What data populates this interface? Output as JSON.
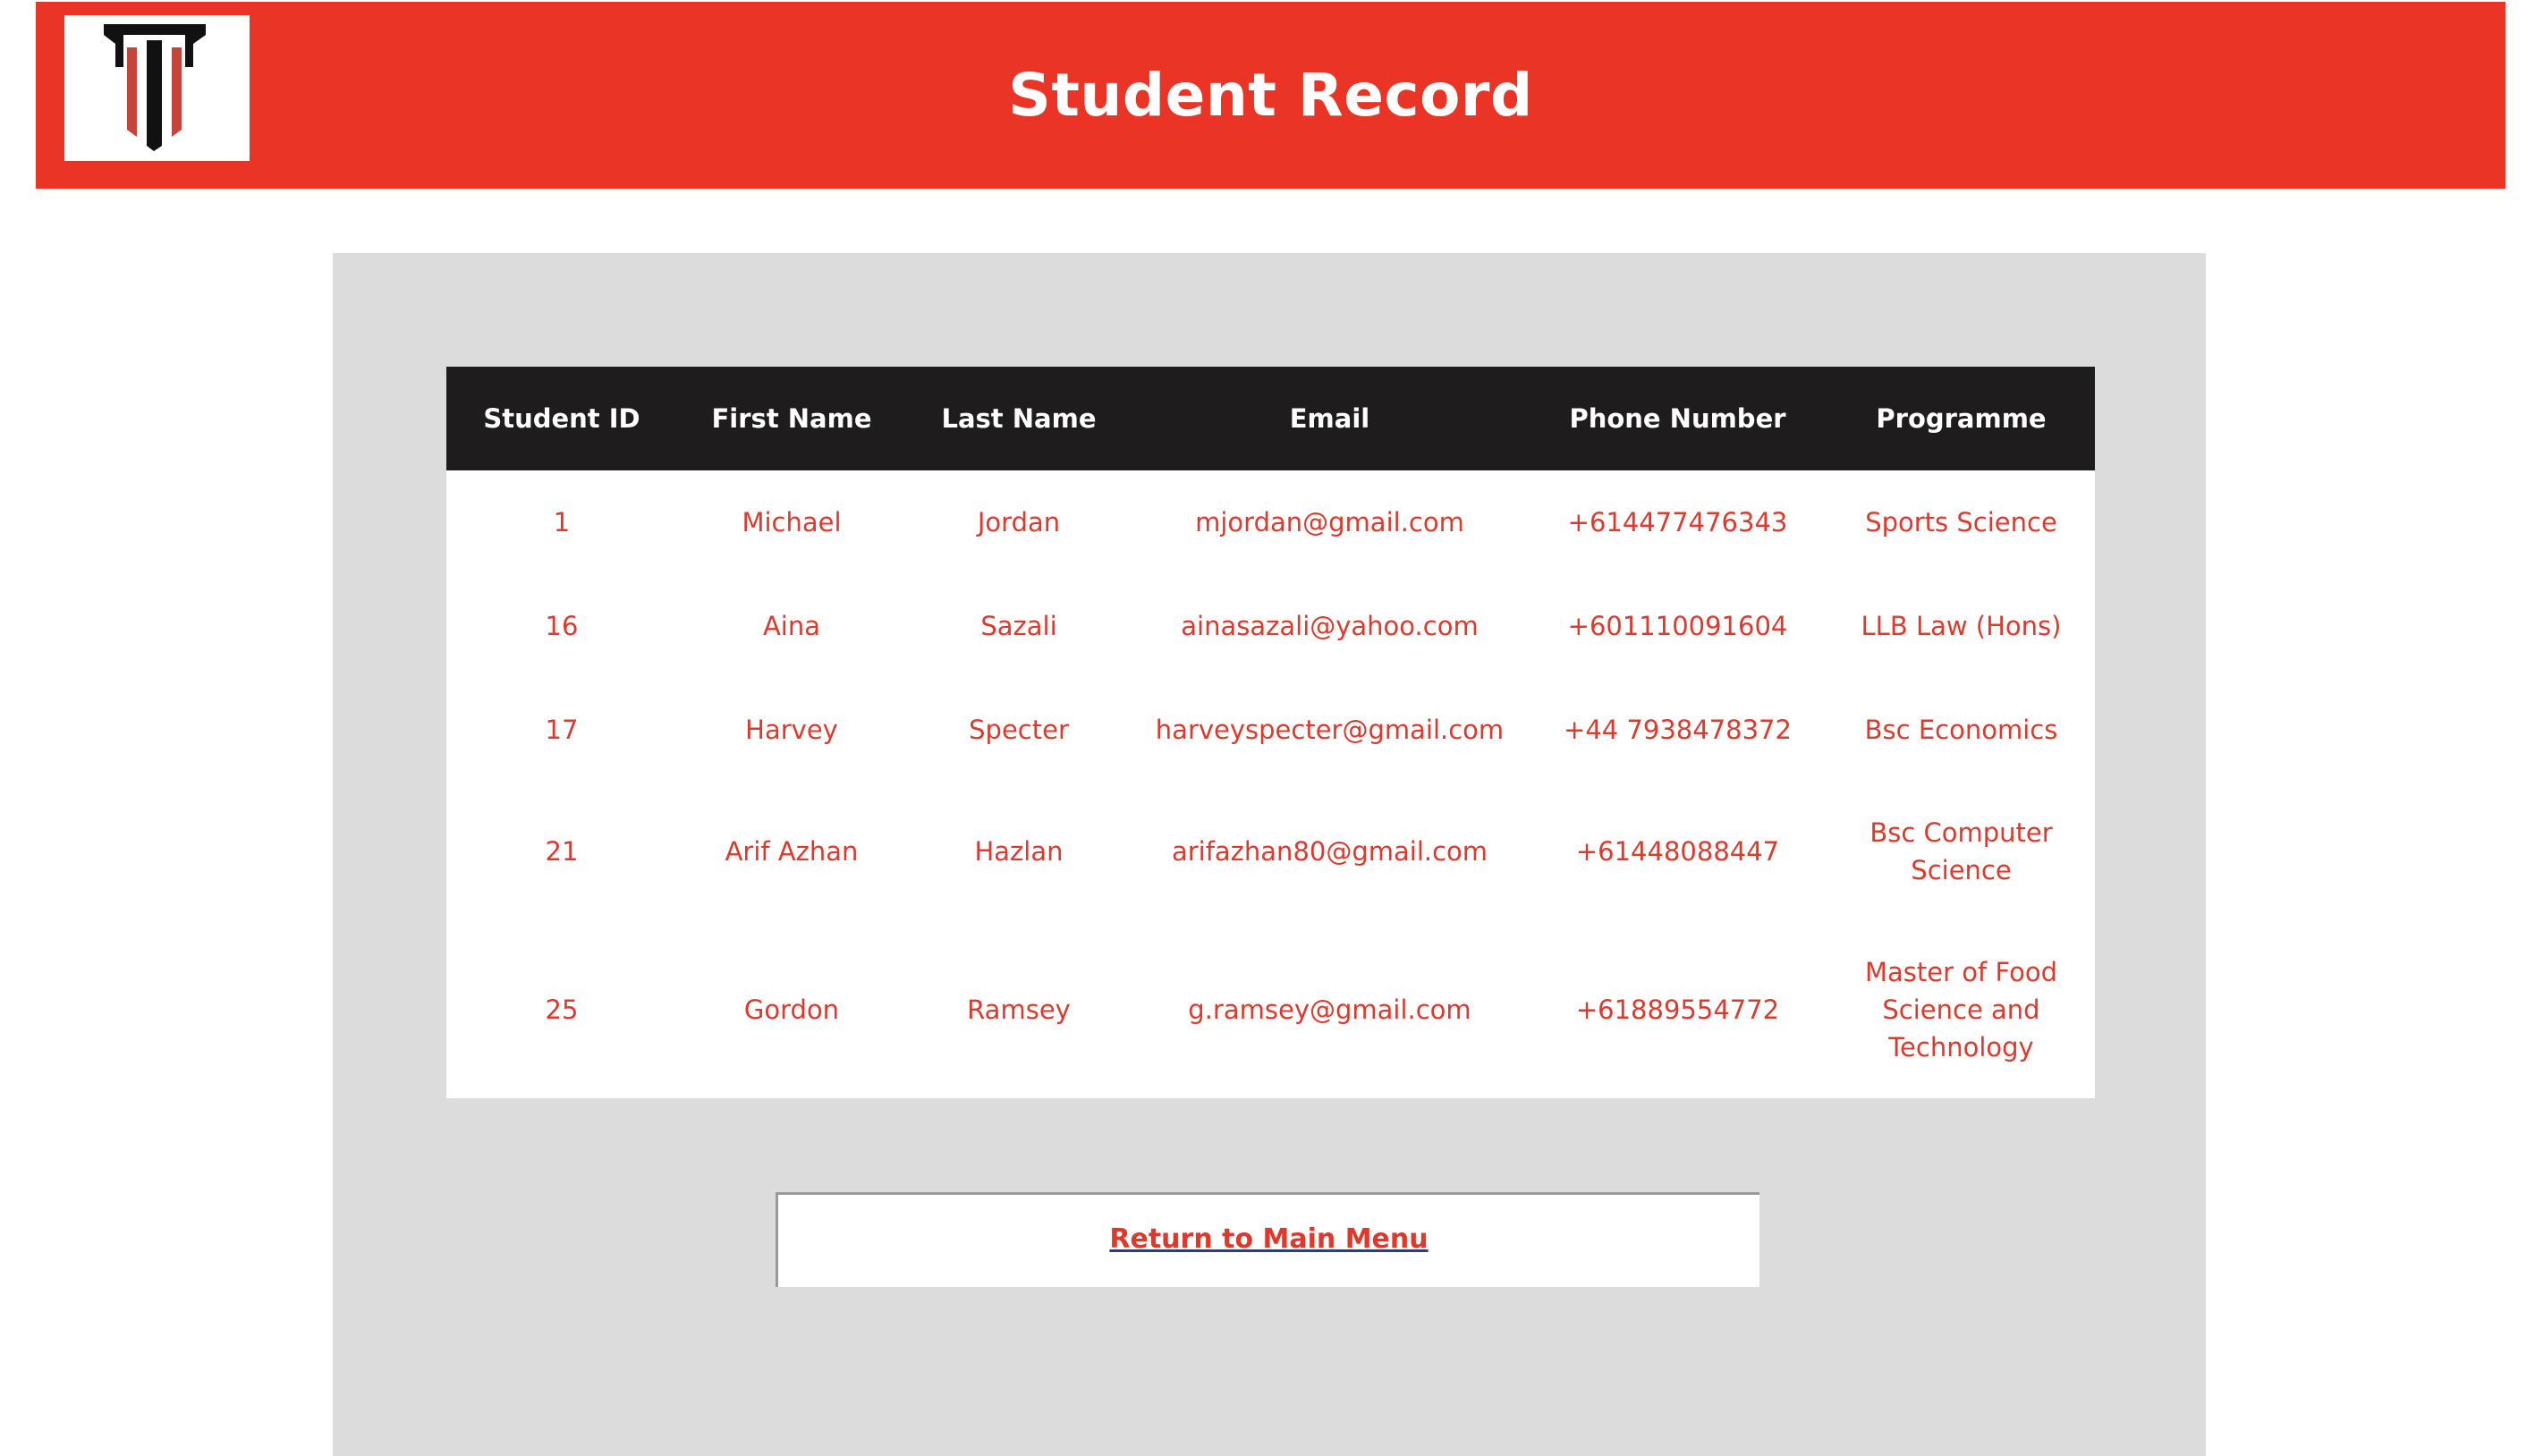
{
  "header": {
    "title": "Student Record",
    "brand_color": "#e93426",
    "logo_icon": "pillar-logo-icon"
  },
  "table": {
    "columns": [
      "Student ID",
      "First Name",
      "Last Name",
      "Email",
      "Phone Number",
      "Programme"
    ],
    "rows": [
      [
        "1",
        "Michael",
        "Jordan",
        "mjordan@gmail.com",
        "+614477476343",
        "Sports Science"
      ],
      [
        "16",
        "Aina",
        "Sazali",
        "ainasazali@yahoo.com",
        "+601110091604",
        "LLB Law (Hons)"
      ],
      [
        "17",
        "Harvey",
        "Specter",
        "harveyspecter@gmail.com",
        "+44 7938478372",
        "Bsc Economics"
      ],
      [
        "21",
        "Arif Azhan",
        "Hazlan",
        "arifazhan80@gmail.com",
        "+61448088447",
        "Bsc Computer Science"
      ],
      [
        "25",
        "Gordon",
        "Ramsey",
        "g.ramsey@gmail.com",
        "+61889554772",
        "Master of Food Science and Technology"
      ]
    ]
  },
  "footer": {
    "return_label": "Return to Main Menu"
  },
  "colors": {
    "header_bg": "#e93426",
    "panel_bg": "#dcdcdc",
    "table_header_bg": "#1e1c1c",
    "cell_text": "#e0382b"
  }
}
